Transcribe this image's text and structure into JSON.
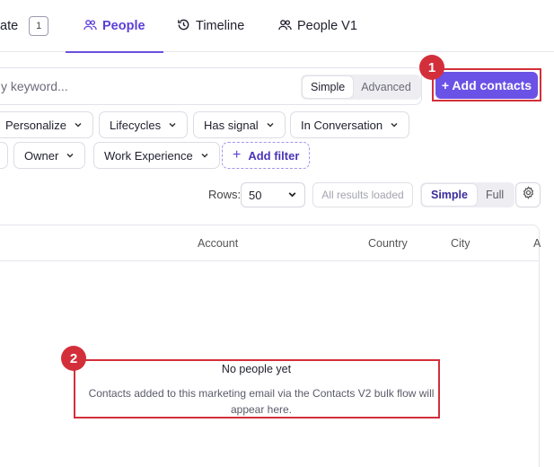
{
  "tabs": {
    "update": {
      "label": "ate",
      "count": "1"
    },
    "people": {
      "label": "People"
    },
    "timeline": {
      "label": "Timeline"
    },
    "people_v1": {
      "label": "People V1"
    }
  },
  "search": {
    "placeholder": "y keyword...",
    "mode_simple": "Simple",
    "mode_advanced": "Advanced"
  },
  "add_contacts": {
    "label": "+ Add contacts"
  },
  "callouts": [
    "1",
    "2"
  ],
  "filters": {
    "personalize": "Personalize",
    "lifecycles": "Lifecycles",
    "has_signal": "Has signal",
    "in_conversation": "In Conversation",
    "owner": "Owner",
    "work_experience": "Work Experience",
    "add_filter": "Add filter"
  },
  "rows": {
    "label": "Rows:",
    "value": "50",
    "all_loaded": "All results loaded",
    "view_simple": "Simple",
    "view_full": "Full"
  },
  "table": {
    "columns": [
      "Account",
      "Country",
      "City",
      "A"
    ]
  },
  "empty_state": {
    "title": "No people yet",
    "line1": "Contacts added to this marketing email via the Contacts V2 bulk flow will",
    "line2": "appear here."
  },
  "colors": {
    "accent": "#6b52e6",
    "callout": "#d32f3a"
  }
}
